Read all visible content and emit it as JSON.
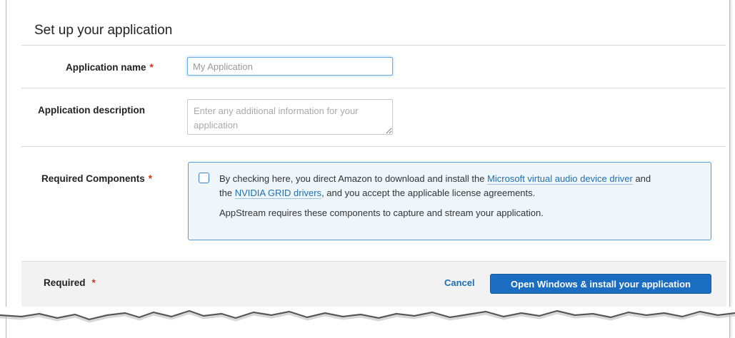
{
  "title": "Set up your application",
  "required_marker": "*",
  "app_name": {
    "label": "Application name",
    "placeholder": "My Application",
    "value": ""
  },
  "app_description": {
    "label": "Application description",
    "placeholder": "Enter any additional information for your application",
    "value": ""
  },
  "components": {
    "label": "Required Components",
    "checked": false,
    "text_before": "By checking here, you direct Amazon to download and install the",
    "link1": "Microsoft virtual audio device driver",
    "text_mid1": "and",
    "text_mid2": "the",
    "link2": "NVIDIA GRID drivers",
    "text_after": ", and you accept the applicable license agreements.",
    "note": "AppStream requires these components to capture and stream your application."
  },
  "footer": {
    "required_label": "Required",
    "cancel_label": "Cancel",
    "submit_label": "Open Windows & install your application"
  },
  "colors": {
    "accent": "#1b6dc1",
    "link": "#1f6fb4",
    "required": "#d13212",
    "panel_bg": "#eef6fc",
    "panel_border": "#4d9fd4"
  }
}
